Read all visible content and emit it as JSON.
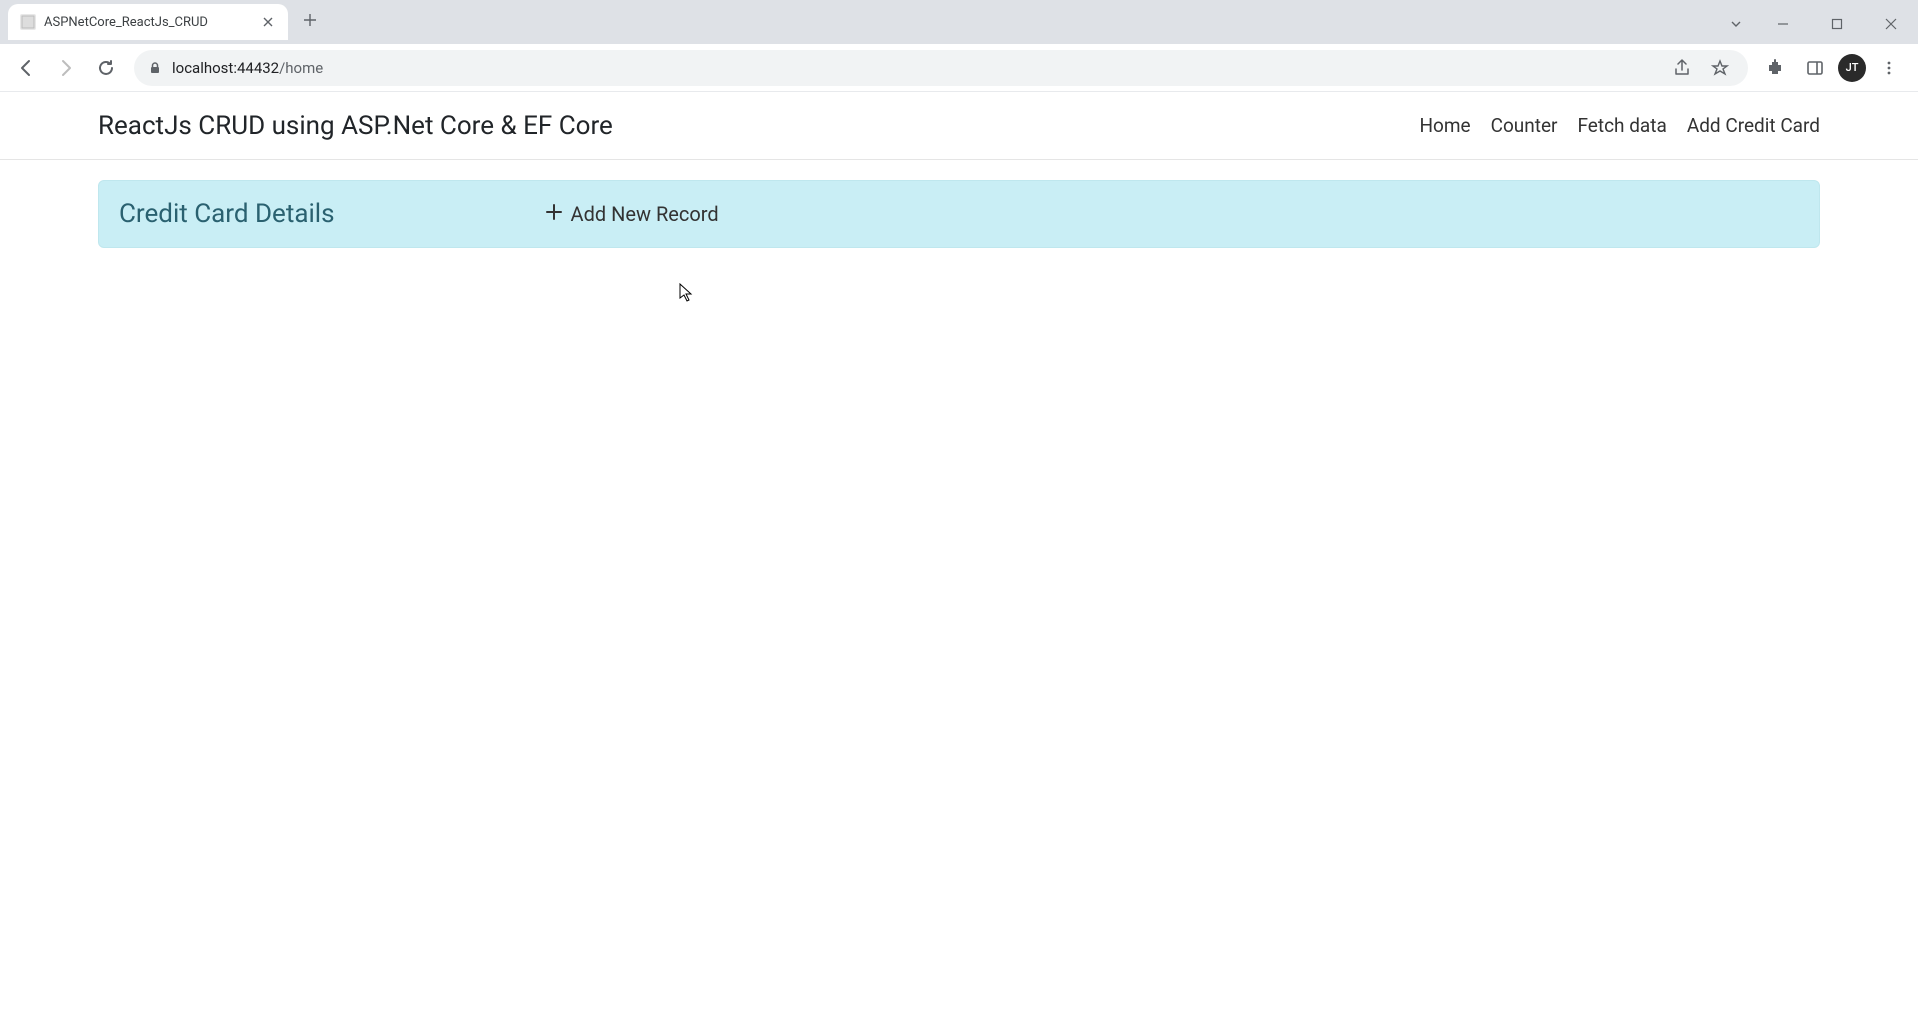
{
  "browser": {
    "tab_title": "ASPNetCore_ReactJs_CRUD",
    "url_domain": "localhost:44432",
    "url_path": "/home"
  },
  "app": {
    "title": "ReactJs CRUD using ASP.Net Core & EF Core",
    "nav": {
      "home": "Home",
      "counter": "Counter",
      "fetch_data": "Fetch data",
      "add_card": "Add Credit Card"
    }
  },
  "main": {
    "header_title": "Credit Card Details",
    "add_button_label": "Add New Record"
  },
  "avatar_initials": "JT"
}
